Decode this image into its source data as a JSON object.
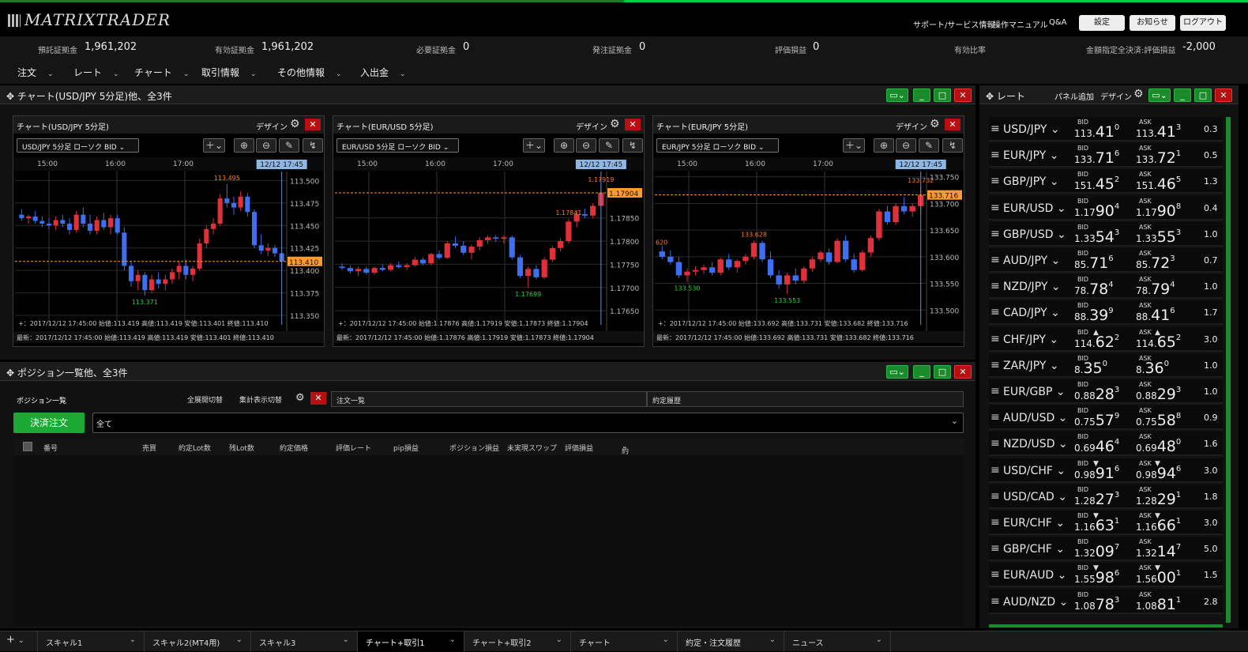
{
  "app": {
    "logo": "MATRIXTRADER",
    "links": [
      "サポート/サービス情報",
      "操作マニュアル",
      "Q&A"
    ],
    "buttons": [
      "設定",
      "お知らせ",
      "ログアウト"
    ]
  },
  "summary": [
    {
      "label": "預託証拠金",
      "value": "1,961,202"
    },
    {
      "label": "有効証拠金",
      "value": "1,961,202"
    },
    {
      "label": "必要証拠金",
      "value": "0"
    },
    {
      "label": "発注証拠金",
      "value": "0"
    },
    {
      "label": "評価損益",
      "value": "0"
    },
    {
      "label": "有効比率",
      "value": ""
    },
    {
      "label": "金額指定全決済:評価損益",
      "value": "-2,000"
    }
  ],
  "menu": [
    "注文",
    "レート",
    "チャート",
    "取引情報",
    "その他情報",
    "入出金"
  ],
  "chartpanel": {
    "title": "チャート(USD/JPY 5分足)他、全3件"
  },
  "charts": [
    {
      "title": "チャート(USD/JPY 5分足)",
      "design": "デザイン",
      "selector": "USD/JPY  5分足  ローソク  BID",
      "times": [
        "15:00",
        "16:00",
        "17:00"
      ],
      "cursor_time": "12/12 17:45",
      "yticks": [
        "113.500",
        "113.475",
        "113.450",
        "113.425",
        "113.400",
        "113.375",
        "113.350"
      ],
      "current": "113.410",
      "high_label": "113.495",
      "low_label": "113.371",
      "info1": "+：2017/12/12 17:45:00  始値:113.419  高値:113.419  安値:113.401  終値:113.410",
      "info2": "最新：2017/12/12 17:45:00  始値:113.419  高値:113.419  安値:113.401  終値:113.410",
      "chart_data": {
        "type": "candlestick",
        "ylim": [
          113.35,
          113.51
        ],
        "ohlc": [
          [
            113.462,
            113.468,
            113.455,
            113.458
          ],
          [
            113.458,
            113.462,
            113.452,
            113.46
          ],
          [
            113.46,
            113.466,
            113.452,
            113.455
          ],
          [
            113.455,
            113.46,
            113.448,
            113.452
          ],
          [
            113.452,
            113.458,
            113.446,
            113.45
          ],
          [
            113.45,
            113.46,
            113.445,
            113.456
          ],
          [
            113.456,
            113.462,
            113.448,
            113.452
          ],
          [
            113.452,
            113.458,
            113.44,
            113.445
          ],
          [
            113.445,
            113.466,
            113.442,
            113.462
          ],
          [
            113.462,
            113.47,
            113.448,
            113.452
          ],
          [
            113.452,
            113.462,
            113.44,
            113.444
          ],
          [
            113.444,
            113.46,
            113.44,
            113.456
          ],
          [
            113.456,
            113.464,
            113.445,
            113.448
          ],
          [
            113.448,
            113.462,
            113.44,
            113.458
          ],
          [
            113.458,
            113.462,
            113.44,
            113.442
          ],
          [
            113.442,
            113.448,
            113.4,
            113.405
          ],
          [
            113.405,
            113.41,
            113.382,
            113.388
          ],
          [
            113.388,
            113.4,
            113.378,
            113.395
          ],
          [
            113.395,
            113.398,
            113.372,
            113.378
          ],
          [
            113.378,
            113.395,
            113.375,
            113.39
          ],
          [
            113.39,
            113.398,
            113.38,
            113.385
          ],
          [
            113.385,
            113.395,
            113.378,
            113.39
          ],
          [
            113.39,
            113.402,
            113.385,
            113.398
          ],
          [
            113.398,
            113.41,
            113.39,
            113.405
          ],
          [
            113.405,
            113.412,
            113.39,
            113.395
          ],
          [
            113.395,
            113.405,
            113.388,
            113.402
          ],
          [
            113.402,
            113.435,
            113.4,
            113.43
          ],
          [
            113.43,
            113.45,
            113.425,
            113.446
          ],
          [
            113.446,
            113.458,
            113.44,
            113.452
          ],
          [
            113.452,
            113.485,
            113.45,
            113.48
          ],
          [
            113.48,
            113.496,
            113.47,
            113.475
          ],
          [
            113.475,
            113.482,
            113.462,
            113.47
          ],
          [
            113.47,
            113.488,
            113.466,
            113.482
          ],
          [
            113.482,
            113.486,
            113.46,
            113.465
          ],
          [
            113.465,
            113.468,
            113.425,
            113.428
          ],
          [
            113.428,
            113.44,
            113.418,
            113.422
          ],
          [
            113.422,
            113.43,
            113.416,
            113.425
          ],
          [
            113.425,
            113.428,
            113.415,
            113.419
          ],
          [
            113.419,
            113.42,
            113.401,
            113.41
          ]
        ]
      }
    },
    {
      "title": "チャート(EUR/USD 5分足)",
      "design": "デザイン",
      "selector": "EUR/USD  5分足  ローソク  BID",
      "times": [
        "15:00",
        "16:00",
        "17:00"
      ],
      "cursor_time": "12/12 17:45",
      "yticks": [
        "1.17850",
        "1.17800",
        "1.17750",
        "1.17700",
        "1.17650"
      ],
      "current": "1.17904",
      "high_label": "1.17919",
      "mid_label": "1.17841",
      "low_label": "1.17699",
      "info1": "+：2017/12/12 17:45:00  始値:1.17876  高値:1.17919  安値:1.17873  終値:1.17904",
      "info2": "最新：2017/12/12 17:45:00  始値:1.17876  高値:1.17919  安値:1.17873  終値:1.17904",
      "chart_data": {
        "type": "candlestick",
        "ylim": [
          1.1764,
          1.1795
        ],
        "ohlc": [
          [
            1.17745,
            1.17752,
            1.17738,
            1.17742
          ],
          [
            1.17742,
            1.17748,
            1.1773,
            1.17735
          ],
          [
            1.17735,
            1.17745,
            1.17725,
            1.1774
          ],
          [
            1.1774,
            1.17745,
            1.17728,
            1.17732
          ],
          [
            1.17732,
            1.17745,
            1.17728,
            1.17742
          ],
          [
            1.17742,
            1.1775,
            1.17735,
            1.17738
          ],
          [
            1.17738,
            1.17752,
            1.17735,
            1.17748
          ],
          [
            1.17748,
            1.17756,
            1.1774,
            1.17744
          ],
          [
            1.17744,
            1.17752,
            1.17738,
            1.17748
          ],
          [
            1.17748,
            1.17766,
            1.17745,
            1.1776
          ],
          [
            1.1776,
            1.17765,
            1.17748,
            1.17752
          ],
          [
            1.17752,
            1.17775,
            1.17748,
            1.17772
          ],
          [
            1.17772,
            1.1778,
            1.1776,
            1.17764
          ],
          [
            1.17764,
            1.178,
            1.17762,
            1.17795
          ],
          [
            1.17795,
            1.1781,
            1.17785,
            1.1779
          ],
          [
            1.1779,
            1.178,
            1.1777,
            1.17775
          ],
          [
            1.17775,
            1.17792,
            1.1776,
            1.17788
          ],
          [
            1.17788,
            1.17808,
            1.1778,
            1.17802
          ],
          [
            1.17802,
            1.17812,
            1.17795,
            1.17808
          ],
          [
            1.17808,
            1.17812,
            1.17798,
            1.17805
          ],
          [
            1.17805,
            1.17812,
            1.17795,
            1.17808
          ],
          [
            1.17808,
            1.17812,
            1.1776,
            1.17765
          ],
          [
            1.17765,
            1.1777,
            1.1772,
            1.17725
          ],
          [
            1.17725,
            1.17745,
            1.177,
            1.1774
          ],
          [
            1.1774,
            1.17748,
            1.17718,
            1.17722
          ],
          [
            1.17722,
            1.17765,
            1.17718,
            1.1776
          ],
          [
            1.1776,
            1.1779,
            1.17755,
            1.17785
          ],
          [
            1.17785,
            1.17806,
            1.17778,
            1.178
          ],
          [
            1.178,
            1.17848,
            1.17795,
            1.17842
          ],
          [
            1.17842,
            1.17865,
            1.1783,
            1.17858
          ],
          [
            1.17858,
            1.1787,
            1.1785,
            1.17855
          ],
          [
            1.17855,
            1.17882,
            1.1785,
            1.17876
          ],
          [
            1.17876,
            1.17919,
            1.17873,
            1.17904
          ]
        ]
      }
    },
    {
      "title": "チャート(EUR/JPY 5分足)",
      "design": "デザイン",
      "selector": "EUR/JPY  5分足  ローソク  BID",
      "times": [
        "15:00",
        "16:00",
        "17:00"
      ],
      "cursor_time": "12/12 17:45",
      "yticks": [
        "133.750",
        "133.700",
        "133.650",
        "133.600",
        "133.550",
        "133.500"
      ],
      "current": "133.716",
      "high_label": "133.732",
      "mid_label": "133.628",
      "left_label": "620",
      "low_label": "133.553",
      "low_label2": "133.530",
      "info1": "+：2017/12/12 17:45:00  始値:133.692  高値:133.731  安値:133.682  終値:133.716",
      "info2": "最新：2017/12/12 17:45:00  始値:133.692  高値:133.731  安値:133.682  終値:133.716",
      "chart_data": {
        "type": "candlestick",
        "ylim": [
          133.49,
          133.76
        ],
        "ohlc": [
          [
            133.61,
            133.62,
            133.595,
            133.6
          ],
          [
            133.6,
            133.612,
            133.585,
            133.59
          ],
          [
            133.59,
            133.6,
            133.56,
            133.565
          ],
          [
            133.565,
            133.578,
            133.553,
            133.572
          ],
          [
            133.572,
            133.582,
            133.565,
            133.575
          ],
          [
            133.575,
            133.585,
            133.568,
            133.58
          ],
          [
            133.58,
            133.59,
            133.565,
            133.57
          ],
          [
            133.57,
            133.598,
            133.565,
            133.595
          ],
          [
            133.595,
            133.605,
            133.575,
            133.58
          ],
          [
            133.58,
            133.595,
            133.57,
            133.592
          ],
          [
            133.592,
            133.605,
            133.585,
            133.6
          ],
          [
            133.6,
            133.63,
            133.595,
            133.626
          ],
          [
            133.626,
            133.63,
            133.59,
            133.595
          ],
          [
            133.595,
            133.61,
            133.56,
            133.565
          ],
          [
            133.565,
            133.575,
            133.54,
            133.548
          ],
          [
            133.548,
            133.57,
            133.53,
            133.565
          ],
          [
            133.565,
            133.578,
            133.548,
            133.555
          ],
          [
            133.555,
            133.582,
            133.55,
            133.578
          ],
          [
            133.578,
            133.6,
            133.572,
            133.595
          ],
          [
            133.595,
            133.612,
            133.59,
            133.608
          ],
          [
            133.608,
            133.615,
            133.585,
            133.59
          ],
          [
            133.59,
            133.635,
            133.588,
            133.63
          ],
          [
            133.63,
            133.64,
            133.59,
            133.595
          ],
          [
            133.595,
            133.605,
            133.57,
            133.575
          ],
          [
            133.575,
            133.612,
            133.572,
            133.608
          ],
          [
            133.608,
            133.64,
            133.6,
            133.635
          ],
          [
            133.635,
            133.69,
            133.63,
            133.685
          ],
          [
            133.685,
            133.695,
            133.66,
            133.665
          ],
          [
            133.665,
            133.7,
            133.66,
            133.695
          ],
          [
            133.695,
            133.712,
            133.68,
            133.685
          ],
          [
            133.685,
            133.7,
            133.675,
            133.695
          ],
          [
            133.695,
            133.732,
            133.682,
            133.716
          ]
        ]
      }
    }
  ],
  "positionpanel": {
    "title": "ポジション一覧他、全3件",
    "tabs": [
      "ポジション一覧",
      "注文一覧",
      "約定履歴"
    ],
    "toggle1": "全展開切替",
    "toggle2": "集計表示切替",
    "settle_button": "決済注文",
    "filter": "全て",
    "columns": [
      "番号",
      "売買",
      "約定Lot数",
      "残Lot数",
      "約定価格",
      "評価レート",
      "pip損益",
      "ポジション損益",
      "未実現スワップ",
      "評価損益",
      "約定日時"
    ]
  },
  "ratepanel": {
    "title": "レート",
    "add_panel": "パネル追加",
    "design": "デザイン",
    "bid_label": "BID",
    "ask_label": "ASK",
    "rates": [
      {
        "pair": "USD/JPY",
        "bid": [
          "113.",
          "41",
          "0"
        ],
        "ask": [
          "113.",
          "41",
          "3"
        ],
        "spread": "0.3",
        "dir": ""
      },
      {
        "pair": "EUR/JPY",
        "bid": [
          "133.",
          "71",
          "6"
        ],
        "ask": [
          "133.",
          "72",
          "1"
        ],
        "spread": "0.5",
        "dir": ""
      },
      {
        "pair": "GBP/JPY",
        "bid": [
          "151.",
          "45",
          "2"
        ],
        "ask": [
          "151.",
          "46",
          "5"
        ],
        "spread": "1.3",
        "dir": ""
      },
      {
        "pair": "EUR/USD",
        "bid": [
          "1.17",
          "90",
          "4"
        ],
        "ask": [
          "1.17",
          "90",
          "8"
        ],
        "spread": "0.4",
        "dir": ""
      },
      {
        "pair": "GBP/USD",
        "bid": [
          "1.33",
          "54",
          "3"
        ],
        "ask": [
          "1.33",
          "55",
          "3"
        ],
        "spread": "1.0",
        "dir": ""
      },
      {
        "pair": "AUD/JPY",
        "bid": [
          "85.",
          "71",
          "6"
        ],
        "ask": [
          "85.",
          "72",
          "3"
        ],
        "spread": "0.7",
        "dir": ""
      },
      {
        "pair": "NZD/JPY",
        "bid": [
          "78.",
          "78",
          "4"
        ],
        "ask": [
          "78.",
          "79",
          "4"
        ],
        "spread": "1.0",
        "dir": ""
      },
      {
        "pair": "CAD/JPY",
        "bid": [
          "88.",
          "39",
          "9"
        ],
        "ask": [
          "88.",
          "41",
          "6"
        ],
        "spread": "1.7",
        "dir": ""
      },
      {
        "pair": "CHF/JPY",
        "bid": [
          "114.",
          "62",
          "2"
        ],
        "ask": [
          "114.",
          "65",
          "2"
        ],
        "spread": "3.0",
        "dir": "up"
      },
      {
        "pair": "ZAR/JPY",
        "bid": [
          "8.",
          "35",
          "0"
        ],
        "ask": [
          "8.",
          "36",
          "0"
        ],
        "spread": "1.0",
        "dir": ""
      },
      {
        "pair": "EUR/GBP",
        "bid": [
          "0.88",
          "28",
          "3"
        ],
        "ask": [
          "0.88",
          "29",
          "3"
        ],
        "spread": "1.0",
        "dir": ""
      },
      {
        "pair": "AUD/USD",
        "bid": [
          "0.75",
          "57",
          "9"
        ],
        "ask": [
          "0.75",
          "58",
          "8"
        ],
        "spread": "0.9",
        "dir": ""
      },
      {
        "pair": "NZD/USD",
        "bid": [
          "0.69",
          "46",
          "4"
        ],
        "ask": [
          "0.69",
          "48",
          "0"
        ],
        "spread": "1.6",
        "dir": ""
      },
      {
        "pair": "USD/CHF",
        "bid": [
          "0.98",
          "91",
          "6"
        ],
        "ask": [
          "0.98",
          "94",
          "6"
        ],
        "spread": "3.0",
        "dir": "down"
      },
      {
        "pair": "USD/CAD",
        "bid": [
          "1.28",
          "27",
          "3"
        ],
        "ask": [
          "1.28",
          "29",
          "1"
        ],
        "spread": "1.8",
        "dir": ""
      },
      {
        "pair": "EUR/CHF",
        "bid": [
          "1.16",
          "63",
          "1"
        ],
        "ask": [
          "1.16",
          "66",
          "1"
        ],
        "spread": "3.0",
        "dir": "down"
      },
      {
        "pair": "GBP/CHF",
        "bid": [
          "1.32",
          "09",
          "7"
        ],
        "ask": [
          "1.32",
          "14",
          "7"
        ],
        "spread": "5.0",
        "dir": ""
      },
      {
        "pair": "EUR/AUD",
        "bid": [
          "1.55",
          "98",
          "6"
        ],
        "ask": [
          "1.56",
          "00",
          "1"
        ],
        "spread": "1.5",
        "dir": "down"
      },
      {
        "pair": "AUD/NZD",
        "bid": [
          "1.08",
          "78",
          "3"
        ],
        "ask": [
          "1.08",
          "81",
          "1"
        ],
        "spread": "2.8",
        "dir": ""
      }
    ]
  },
  "bottomtabs": [
    "スキャル1",
    "スキャル2(MT4用)",
    "スキャル3",
    "チャート+取引1",
    "チャート+取引2",
    "チャート",
    "約定・注文履歴",
    "ニュース"
  ],
  "colors": {
    "accent_green": "#1a8a2a",
    "up_candle": "#e0303a",
    "down_candle": "#3d6ff0",
    "close_red": "#b81010",
    "price_line": "#ff9a2e"
  }
}
